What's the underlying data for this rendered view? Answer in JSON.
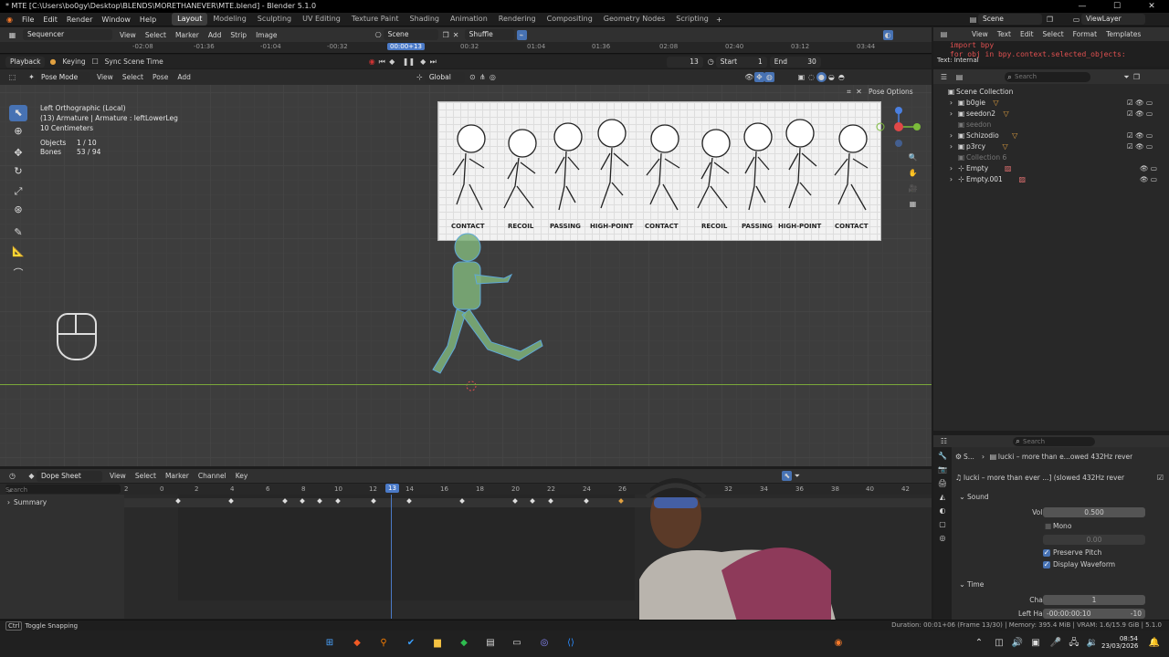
{
  "window": {
    "title": "* MTE [C:\\Users\\bo0gy\\Desktop\\BLENDS\\MORETHANEVER\\MTE.blend] - Blender 5.1.0"
  },
  "menu": [
    "File",
    "Edit",
    "Render",
    "Window",
    "Help"
  ],
  "workspaces": [
    "Layout",
    "Modeling",
    "Sculpting",
    "UV Editing",
    "Texture Paint",
    "Shading",
    "Animation",
    "Rendering",
    "Compositing",
    "Geometry Nodes",
    "Scripting"
  ],
  "active_workspace": "Layout",
  "scene_name": "Scene",
  "view_layer": "ViewLayer",
  "sequencer": {
    "editor_type": "Sequencer",
    "menus": [
      "View",
      "Select",
      "Marker",
      "Add",
      "Strip",
      "Image"
    ],
    "scene": "Scene",
    "shuffle": "Shuffle",
    "ruler": [
      "-02:08",
      "-01:36",
      "-01:04",
      "-00:32",
      "00:00+13",
      "00:32",
      "01:04",
      "01:36",
      "02:08",
      "02:40",
      "03:12",
      "03:44"
    ],
    "playback": "Playback",
    "keying": "Keying",
    "sync": "Sync Scene Time",
    "current_frame": "13",
    "start_label": "Start",
    "start": "1",
    "end_label": "End",
    "end": "30"
  },
  "viewport": {
    "mode": "Pose Mode",
    "menus": [
      "View",
      "Select",
      "Pose",
      "Add"
    ],
    "transform": "Global",
    "pose_options": "Pose Options",
    "info_line1": "Left Orthographic (Local)",
    "info_line2": "(13) Armature | Armature : leftLowerLeg",
    "info_line3": "10 Centimeters",
    "objects_label": "Objects",
    "objects_value": "1 / 10",
    "bones_label": "Bones",
    "bones_value": "53 / 94",
    "poses": [
      "CONTACT",
      "RECOIL",
      "PASSING",
      "HIGH-POINT",
      "CONTACT",
      "RECOIL",
      "PASSING",
      "HIGH-POINT",
      "CONTACT"
    ]
  },
  "dopesheet": {
    "editor": "Dope Sheet",
    "menus": [
      "View",
      "Select",
      "Marker",
      "Channel",
      "Key"
    ],
    "search_placeholder": "Search",
    "summary": "Summary",
    "ruler": [
      "2",
      "0",
      "2",
      "4",
      "6",
      "8",
      "10",
      "12",
      "13",
      "14",
      "16",
      "18",
      "20",
      "22",
      "24",
      "26",
      "28",
      "30",
      "32",
      "34",
      "36",
      "38",
      "40",
      "42"
    ],
    "current_frame": "13"
  },
  "text_editor": {
    "menus": [
      "View",
      "Text",
      "Edit",
      "Select",
      "Format",
      "Templates"
    ],
    "text_name": "Text: Internal",
    "line1": "import bpy",
    "line2": "for obj in bpy.context.selected_objects:"
  },
  "outliner": {
    "search_placeholder": "Search",
    "root": "Scene Collection",
    "items": [
      "b0gie",
      "seedon2",
      "seedon",
      "Schizodio",
      "p3rcy",
      "Collection 6",
      "Empty",
      "Empty.001"
    ]
  },
  "properties": {
    "search_placeholder": "Search",
    "breadcrumb": "lucki – more than e...owed 432Hz rever",
    "strip_name": "lucki – more than ever ...] (slowed 432Hz rever",
    "sound_panel": "Sound",
    "volume_label": "Volume",
    "volume": "0.500",
    "mono": "Mono",
    "pan_label": "Pan",
    "pan": "0.00",
    "preserve_pitch": "Preserve Pitch",
    "display_waveform": "Display Waveform",
    "time_panel": "Time",
    "channel_label": "Channel",
    "channel": "1",
    "left_handle_label": "Left Handle",
    "left_handle": "-00:00:00:10",
    "left_handle_val": "-10"
  },
  "status": {
    "hint_key": "Ctrl",
    "hint": "Toggle Snapping",
    "right": "Duration: 00:01+06 (Frame 13/30) | Memory: 395.4 MiB | VRAM: 1.6/15.9 GiB | 5.1.0"
  },
  "taskbar": {
    "time": "08:54",
    "date": "23/03/2026"
  },
  "colors": {
    "accent": "#4772b3",
    "playhead": "#4b7ac7",
    "selected_bone": "#6fbf6f"
  }
}
